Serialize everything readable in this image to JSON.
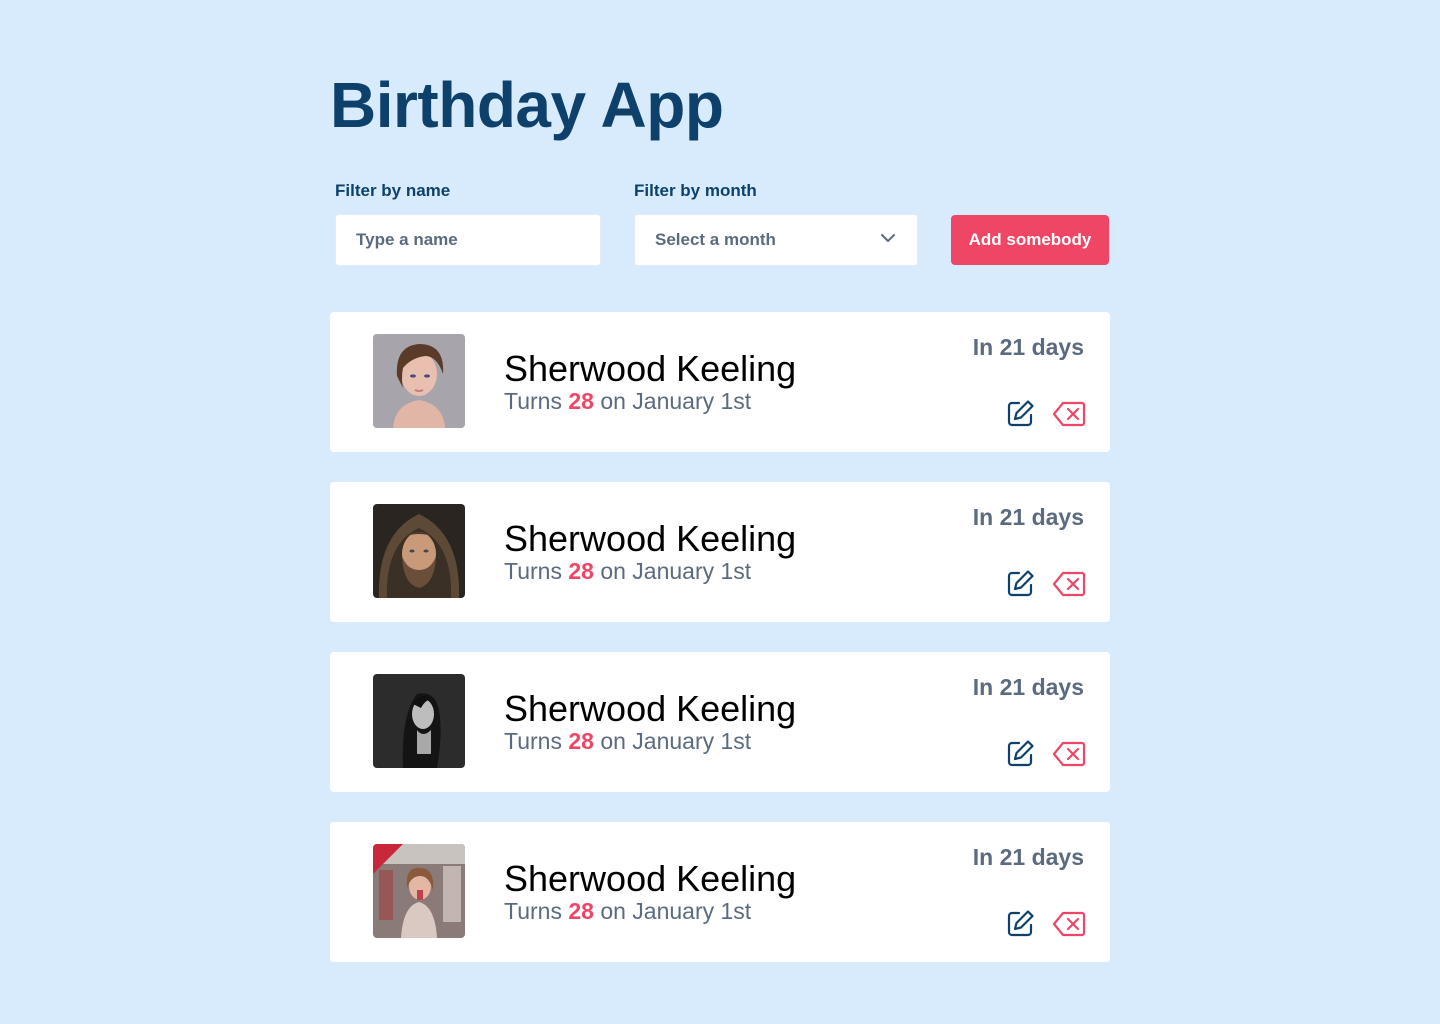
{
  "app": {
    "title": "Birthday App"
  },
  "filters": {
    "name_label": "Filter by name",
    "name_placeholder": "Type a name",
    "name_value": "",
    "month_label": "Filter by month",
    "month_selected": "Select a month",
    "add_button_label": "Add somebody"
  },
  "colors": {
    "background": "#d7ebfd",
    "primary": "#0d416b",
    "accent": "#ef4666",
    "muted": "#5b6b7f"
  },
  "people": [
    {
      "name": "Sherwood Keeling",
      "turns_prefix": "Turns",
      "age": "28",
      "date_text": "on January 1st",
      "countdown": "In 21 days",
      "photo": "woman-short-hair-portrait",
      "edit_icon": "edit-icon",
      "delete_icon": "delete-icon"
    },
    {
      "name": "Sherwood Keeling",
      "turns_prefix": "Turns",
      "age": "28",
      "date_text": "on January 1st",
      "countdown": "In 21 days",
      "photo": "bearded-man-fur-hood-portrait",
      "edit_icon": "edit-icon",
      "delete_icon": "delete-icon"
    },
    {
      "name": "Sherwood Keeling",
      "turns_prefix": "Turns",
      "age": "28",
      "date_text": "on January 1st",
      "countdown": "In 21 days",
      "photo": "woman-black-and-white-profile",
      "edit_icon": "edit-icon",
      "delete_icon": "delete-icon"
    },
    {
      "name": "Sherwood Keeling",
      "turns_prefix": "Turns",
      "age": "28",
      "date_text": "on January 1st",
      "countdown": "In 21 days",
      "photo": "woman-city-lights-portrait",
      "edit_icon": "edit-icon",
      "delete_icon": "delete-icon"
    }
  ]
}
